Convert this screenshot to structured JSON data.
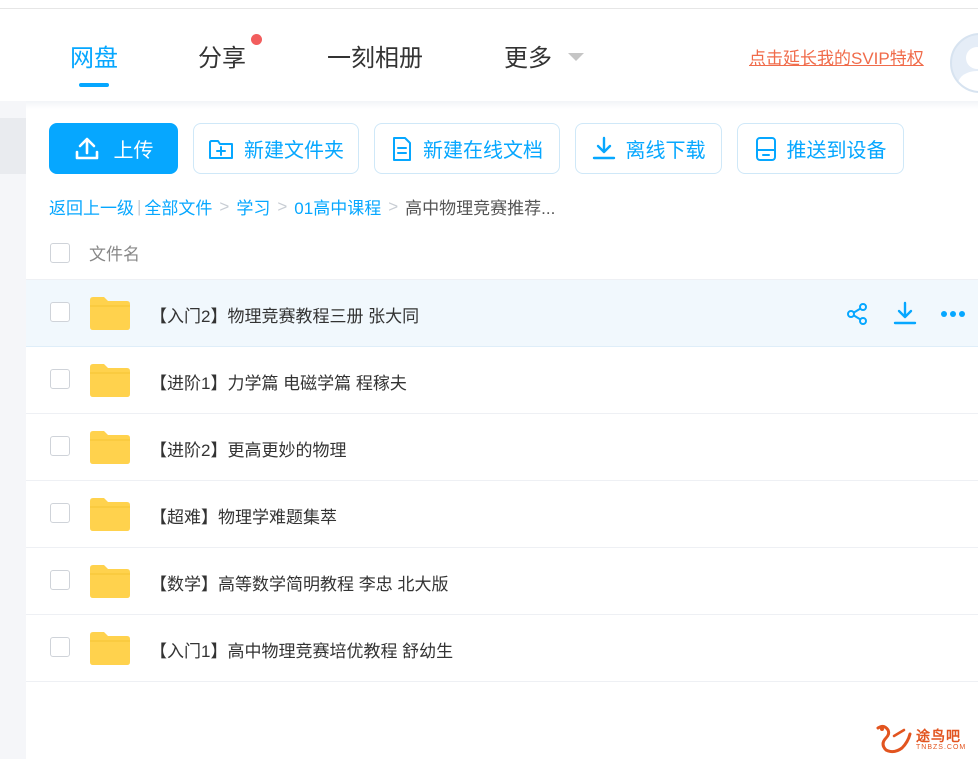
{
  "nav": {
    "tabs": [
      {
        "label": "网盘",
        "active": true
      },
      {
        "label": "分享",
        "badge": true
      },
      {
        "label": "一刻相册"
      },
      {
        "label": "更多"
      }
    ],
    "svip_link": "点击延长我的SVIP特权"
  },
  "toolbar": {
    "upload": "上传",
    "new_folder": "新建文件夹",
    "new_doc": "新建在线文档",
    "offline_download": "离线下载",
    "push_device": "推送到设备"
  },
  "breadcrumb": {
    "back": "返回上一级",
    "separator_bar": "|",
    "items": [
      "全部文件",
      "学习",
      "01高中课程"
    ],
    "current": "高中物理竞赛推荐...",
    "separator": ">"
  },
  "table": {
    "column_name": "文件名",
    "rows": [
      {
        "name": "【入门2】物理竞赛教程三册 张大同",
        "hover": true
      },
      {
        "name": "【进阶1】力学篇 电磁学篇 程稼夫"
      },
      {
        "name": "【进阶2】更高更妙的物理"
      },
      {
        "name": "【超难】物理学难题集萃"
      },
      {
        "name": "【数学】高等数学简明教程 李忠 北大版"
      },
      {
        "name": "【入门1】高中物理竞赛培优教程 舒幼生"
      }
    ]
  },
  "watermark": {
    "text": "途鸟吧",
    "sub": "TNBZS.COM"
  },
  "colors": {
    "accent": "#06a7ff",
    "svip": "#f06b4a",
    "folder": "#ffd24d",
    "badge": "#f25d5d",
    "row_hover": "#f1f8fd"
  },
  "icons": {
    "upload": "upload-icon",
    "new_folder": "folder-plus-icon",
    "new_doc": "document-icon",
    "offline_download": "download-icon",
    "push_device": "device-icon",
    "row_share": "share-icon",
    "row_download": "download-icon",
    "row_more": "more-icon"
  }
}
